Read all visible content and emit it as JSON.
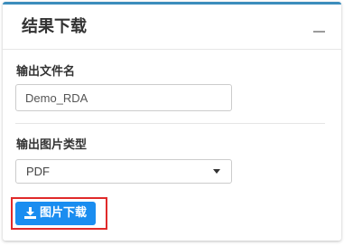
{
  "panel": {
    "title": "结果下载",
    "collapse_icon": "minus-icon",
    "accent_color": "#3c8dbc"
  },
  "filename_field": {
    "label": "输出文件名",
    "value": "Demo_RDA"
  },
  "image_type_field": {
    "label": "输出图片类型",
    "selected": "PDF",
    "caret_icon": "caret-down-icon"
  },
  "download_button": {
    "label": "图片下载",
    "icon": "download-icon",
    "color": "#1a8df0"
  },
  "highlight_color": "#e02a2a"
}
